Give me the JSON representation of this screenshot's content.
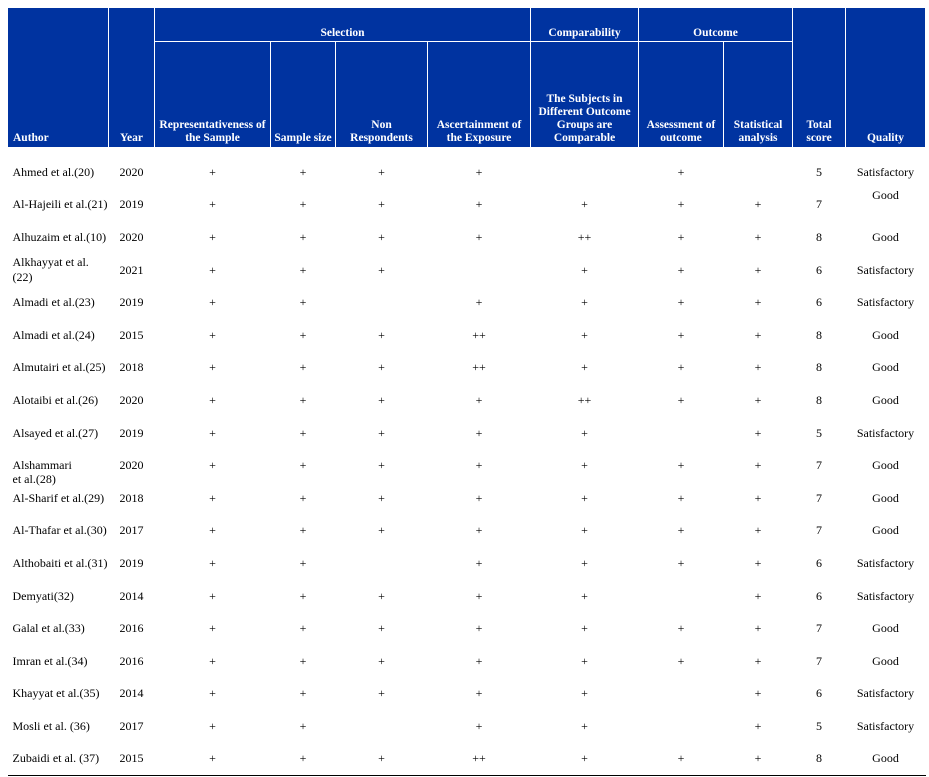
{
  "headers": {
    "author": "Author",
    "year": "Year",
    "selection": "Selection",
    "comparability": "Comparability",
    "outcome": "Outcome",
    "total_score": "Total score",
    "quality": "Quality",
    "sub": {
      "representativeness": "Representativeness of the Sample",
      "sample_size": "Sample size",
      "non_respondents": "Non Respondents",
      "ascertainment": "Ascertainment of the Exposure",
      "comparable": "The Subjects in Different Outcome Groups are Comparable",
      "assessment": "Assessment of outcome",
      "statistical": "Statistical analysis"
    }
  },
  "rows": [
    {
      "author": "Ahmed et al.(20)",
      "year": "2020",
      "rep": "+",
      "size": "+",
      "nonresp": "+",
      "ascert": "+",
      "comp": "",
      "assess": "+",
      "stat": "",
      "total": "5",
      "quality": "Satisfactory"
    },
    {
      "author": "Al-Hajeili et al.(21)",
      "year": "2019",
      "rep": "+",
      "size": "+",
      "nonresp": "+",
      "ascert": "+",
      "comp": "+",
      "assess": "+",
      "stat": "+",
      "total": "7",
      "quality": "Good"
    },
    {
      "author": "Alhuzaim et al.(10)",
      "year": "2020",
      "rep": "+",
      "size": "+",
      "nonresp": "+",
      "ascert": "+",
      "comp": "++",
      "assess": "+",
      "stat": "+",
      "total": "8",
      "quality": "Good"
    },
    {
      "author": "Alkhayyat et al.(22)",
      "year": "2021",
      "rep": "+",
      "size": "+",
      "nonresp": "+",
      "ascert": "",
      "comp": "+",
      "assess": "+",
      "stat": "+",
      "total": "6",
      "quality": "Satisfactory"
    },
    {
      "author": "Almadi et al.(23)",
      "year": "2019",
      "rep": "+",
      "size": "+",
      "nonresp": "",
      "ascert": "+",
      "comp": "+",
      "assess": "+",
      "stat": "+",
      "total": "6",
      "quality": "Satisfactory"
    },
    {
      "author": "Almadi et al.(24)",
      "year": "2015",
      "rep": "+",
      "size": "+",
      "nonresp": "+",
      "ascert": "++",
      "comp": "+",
      "assess": "+",
      "stat": "+",
      "total": "8",
      "quality": "Good"
    },
    {
      "author": "Almutairi et al.(25)",
      "year": "2018",
      "rep": "+",
      "size": "+",
      "nonresp": "+",
      "ascert": "++",
      "comp": "+",
      "assess": "+",
      "stat": "+",
      "total": "8",
      "quality": "Good"
    },
    {
      "author": "Alotaibi et al.(26)",
      "year": "2020",
      "rep": "+",
      "size": "+",
      "nonresp": "+",
      "ascert": "+",
      "comp": "++",
      "assess": "+",
      "stat": "+",
      "total": "8",
      "quality": "Good"
    },
    {
      "author": "Alsayed et al.(27)",
      "year": "2019",
      "rep": "+",
      "size": "+",
      "nonresp": "+",
      "ascert": "+",
      "comp": "+",
      "assess": "",
      "stat": "+",
      "total": "5",
      "quality": "Satisfactory"
    },
    {
      "author": "Alshammari et al.(28)",
      "year": "2020",
      "rep": "+",
      "size": "+",
      "nonresp": "+",
      "ascert": "+",
      "comp": "+",
      "assess": "+",
      "stat": "+",
      "total": "7",
      "quality": "Good"
    },
    {
      "author": "Al-Sharif et al.(29)",
      "year": "2018",
      "rep": "+",
      "size": "+",
      "nonresp": "+",
      "ascert": "+",
      "comp": "+",
      "assess": "+",
      "stat": "+",
      "total": "7",
      "quality": "Good"
    },
    {
      "author": "Al-Thafar et al.(30)",
      "year": "2017",
      "rep": "+",
      "size": "+",
      "nonresp": "+",
      "ascert": "+",
      "comp": "+",
      "assess": "+",
      "stat": "+",
      "total": "7",
      "quality": "Good"
    },
    {
      "author": "Althobaiti et al.(31)",
      "year": "2019",
      "rep": "+",
      "size": "+",
      "nonresp": "",
      "ascert": "+",
      "comp": "+",
      "assess": "+",
      "stat": "+",
      "total": "6",
      "quality": "Satisfactory"
    },
    {
      "author": "Demyati(32)",
      "year": "2014",
      "rep": "+",
      "size": "+",
      "nonresp": "+",
      "ascert": "+",
      "comp": "+",
      "assess": "",
      "stat": "+",
      "total": "6",
      "quality": "Satisfactory"
    },
    {
      "author": "Galal et al.(33)",
      "year": "2016",
      "rep": "+",
      "size": "+",
      "nonresp": "+",
      "ascert": "+",
      "comp": "+",
      "assess": "+",
      "stat": "+",
      "total": "7",
      "quality": "Good"
    },
    {
      "author": "Imran et al.(34)",
      "year": "2016",
      "rep": "+",
      "size": "+",
      "nonresp": "+",
      "ascert": "+",
      "comp": "+",
      "assess": "+",
      "stat": "+",
      "total": "7",
      "quality": "Good"
    },
    {
      "author": "Khayyat et al.(35)",
      "year": "2014",
      "rep": "+",
      "size": "+",
      "nonresp": "+",
      "ascert": "+",
      "comp": "+",
      "assess": "",
      "stat": "+",
      "total": "6",
      "quality": "Satisfactory"
    },
    {
      "author": "Mosli et al. (36)",
      "year": "2017",
      "rep": "+",
      "size": "+",
      "nonresp": "",
      "ascert": "+",
      "comp": "+",
      "assess": "",
      "stat": "+",
      "total": "5",
      "quality": "Satisfactory"
    },
    {
      "author": "Zubaidi et al. (37)",
      "year": "2015",
      "rep": "+",
      "size": "+",
      "nonresp": "+",
      "ascert": "++",
      "comp": "+",
      "assess": "+",
      "stat": "+",
      "total": "8",
      "quality": "Good"
    }
  ],
  "colors": {
    "header_bg": "#0033a0",
    "header_text": "#ffffff"
  }
}
